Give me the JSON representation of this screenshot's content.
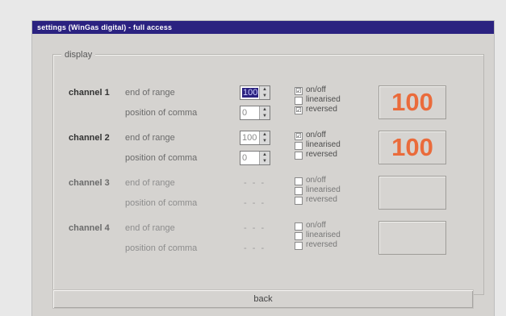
{
  "window": {
    "title": "settings (WinGas digital) - full access"
  },
  "group": {
    "label": "display"
  },
  "channels": [
    {
      "label": "channel 1",
      "end_of_range_label": "end of range",
      "comma_label": "position of comma",
      "end_of_range": "100",
      "comma_position": "0",
      "checkboxes": [
        {
          "label": "on/off",
          "checked": "☑"
        },
        {
          "label": "linearised",
          "checked": ""
        },
        {
          "label": "reversed",
          "checked": "☑"
        }
      ],
      "display_value": "100"
    },
    {
      "label": "channel 2",
      "end_of_range_label": "end of range",
      "comma_label": "position of comma",
      "end_of_range": "100",
      "comma_position": "0",
      "checkboxes": [
        {
          "label": "on/off",
          "checked": "☑"
        },
        {
          "label": "linearised",
          "checked": ""
        },
        {
          "label": "reversed",
          "checked": ""
        }
      ],
      "display_value": "100"
    },
    {
      "label": "channel 3",
      "end_of_range_label": "end of range",
      "comma_label": "position of comma",
      "end_of_range": "- - -",
      "comma_position": "- - -",
      "checkboxes": [
        {
          "label": "on/off",
          "checked": ""
        },
        {
          "label": "linearised",
          "checked": ""
        },
        {
          "label": "reversed",
          "checked": ""
        }
      ],
      "display_value": ""
    },
    {
      "label": "channel 4",
      "end_of_range_label": "end of range",
      "comma_label": "position of comma",
      "end_of_range": "- - -",
      "comma_position": "- - -",
      "checkboxes": [
        {
          "label": "on/off",
          "checked": ""
        },
        {
          "label": "linearised",
          "checked": ""
        },
        {
          "label": "reversed",
          "checked": ""
        }
      ],
      "display_value": ""
    }
  ],
  "footer": {
    "back_label": "back"
  },
  "colors": {
    "titlebar": "#2b2280",
    "window_bg": "#d5d3d0",
    "display_digits": "#ea6b3b"
  }
}
